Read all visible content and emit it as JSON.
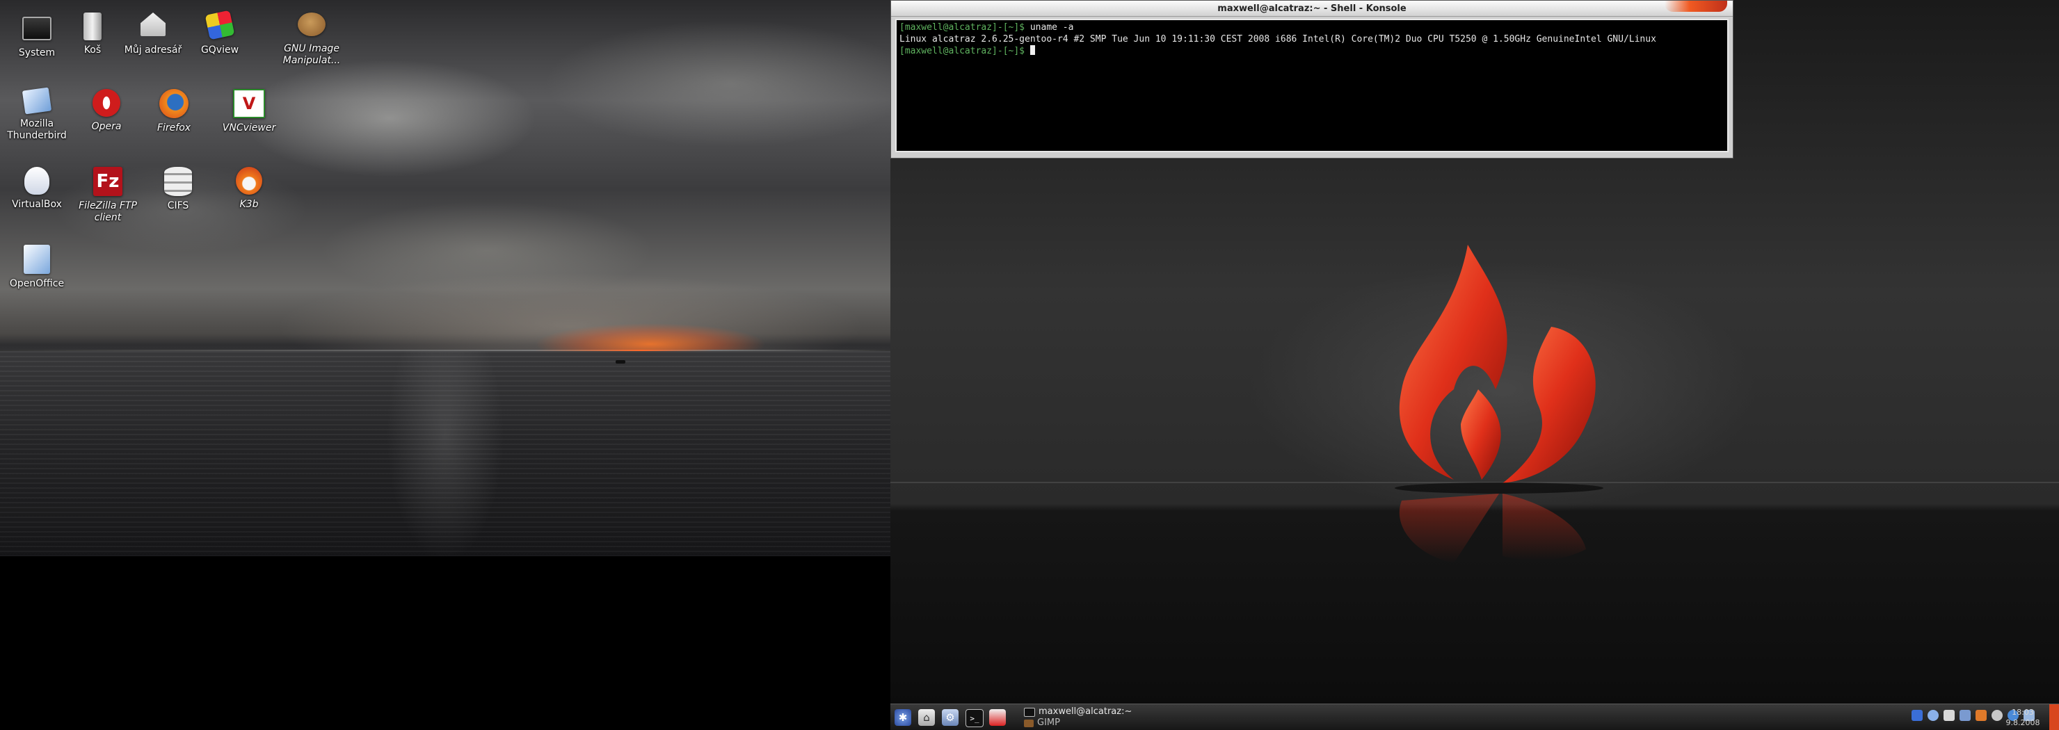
{
  "desktop_icons": [
    {
      "label": "System",
      "icon": "monitor-icon",
      "italic": false
    },
    {
      "label": "Koš",
      "icon": "trash-icon",
      "italic": false
    },
    {
      "label": "Můj adresář",
      "icon": "home-icon",
      "italic": false
    },
    {
      "label": "GQview",
      "icon": "gqview-icon",
      "italic": false
    },
    {
      "label": "GNU Image Manipulat...",
      "icon": "gimp-icon",
      "italic": true
    },
    {
      "label": "Mozilla Thunderbird",
      "icon": "thunderbird-icon",
      "italic": false
    },
    {
      "label": "Opera",
      "icon": "opera-icon",
      "italic": true
    },
    {
      "label": "Firefox",
      "icon": "firefox-icon",
      "italic": true
    },
    {
      "label": "VNCviewer",
      "icon": "vnc-icon",
      "italic": true
    },
    {
      "label": "VirtualBox",
      "icon": "virtualbox-icon",
      "italic": false
    },
    {
      "label": "FileZilla FTP client",
      "icon": "filezilla-icon",
      "italic": true
    },
    {
      "label": "CIFS",
      "icon": "drive-icon",
      "italic": false
    },
    {
      "label": "K3b",
      "icon": "k3b-icon",
      "italic": true
    },
    {
      "label": "OpenOffice",
      "icon": "openoffice-icon",
      "italic": false
    }
  ],
  "konsole": {
    "title": "maxwell@alcatraz:~ - Shell - Konsole",
    "prompt1": "[maxwell@alcatraz]-[~]$ ",
    "command1": "uname -a",
    "output1": "Linux alcatraz 2.6.25-gentoo-r4 #2 SMP Tue Jun 10 19:11:30 CEST 2008 i686 Intel(R) Core(TM)2 Duo CPU T5250 @ 1.50GHz GenuineIntel GNU/Linux",
    "prompt2": "[maxwell@alcatraz]-[~]$ "
  },
  "taskbar": {
    "launchers": [
      "kde-menu-icon",
      "home-icon",
      "settings-icon",
      "terminal-icon",
      "pdf-icon"
    ],
    "tasks": [
      {
        "label": "maxwell@alcatraz:~",
        "icon": "konsole-task-icon"
      },
      {
        "label": "GIMP",
        "icon": "gimp-task-icon"
      }
    ],
    "clock_time": "18:03",
    "clock_date": "9.8.2008",
    "colors": {
      "accent": "#d8461e",
      "flame": "#e0301a"
    }
  }
}
